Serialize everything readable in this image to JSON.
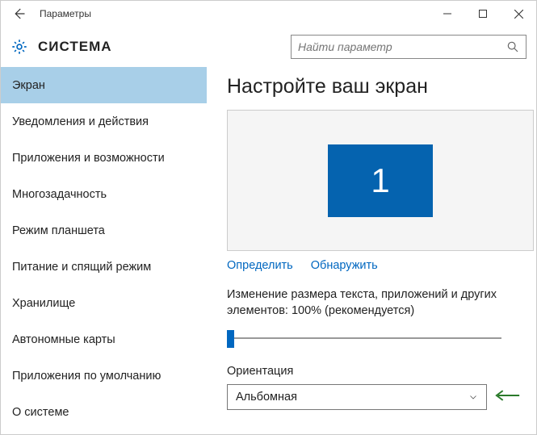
{
  "titlebar": {
    "title": "Параметры"
  },
  "header": {
    "title": "СИСТЕМА",
    "search_placeholder": "Найти параметр"
  },
  "sidebar": {
    "items": [
      {
        "label": "Экран",
        "selected": true
      },
      {
        "label": "Уведомления и действия",
        "selected": false
      },
      {
        "label": "Приложения и возможности",
        "selected": false
      },
      {
        "label": "Многозадачность",
        "selected": false
      },
      {
        "label": "Режим планшета",
        "selected": false
      },
      {
        "label": "Питание и спящий режим",
        "selected": false
      },
      {
        "label": "Хранилище",
        "selected": false
      },
      {
        "label": "Автономные карты",
        "selected": false
      },
      {
        "label": "Приложения по умолчанию",
        "selected": false
      },
      {
        "label": "О системе",
        "selected": false
      }
    ]
  },
  "main": {
    "heading": "Настройте ваш экран",
    "display_number": "1",
    "identify_label": "Определить",
    "detect_label": "Обнаружить",
    "scale_description": "Изменение размера текста, приложений и других элементов: 100% (рекомендуется)",
    "orientation_label": "Ориентация",
    "orientation_value": "Альбомная"
  }
}
